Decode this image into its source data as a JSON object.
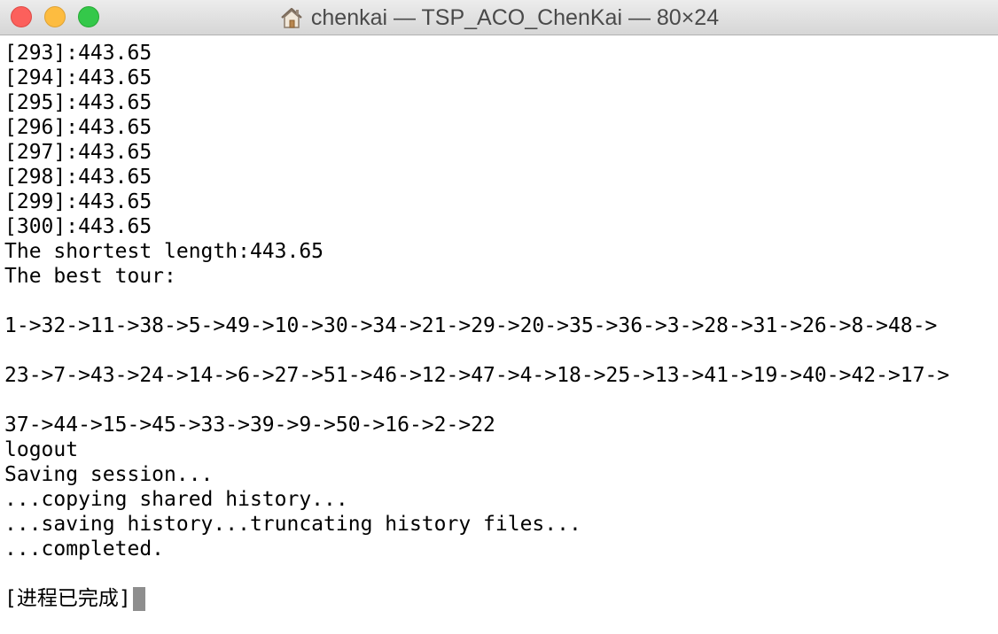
{
  "window": {
    "title": "chenkai — TSP_ACO_ChenKai — 80×24",
    "title_icon": "home-icon",
    "traffic_lights": {
      "close_color": "#fc605c",
      "minimize_color": "#fdbc40",
      "zoom_color": "#34c84a"
    }
  },
  "terminal": {
    "lines": [
      "[293]:443.65",
      "[294]:443.65",
      "[295]:443.65",
      "[296]:443.65",
      "[297]:443.65",
      "[298]:443.65",
      "[299]:443.65",
      "[300]:443.65",
      "The shortest length:443.65",
      "The best tour:",
      "",
      "1->32->11->38->5->49->10->30->34->21->29->20->35->36->3->28->31->26->8->48->",
      "",
      "23->7->43->24->14->6->27->51->46->12->47->4->18->25->13->41->19->40->42->17->",
      "",
      "37->44->15->45->33->39->9->50->16->2->22",
      "logout",
      "Saving session...",
      "...copying shared history...",
      "...saving history...truncating history files...",
      "...completed.",
      ""
    ],
    "final_line": "[进程已完成]",
    "cursor_color": "#8e8e8e"
  }
}
